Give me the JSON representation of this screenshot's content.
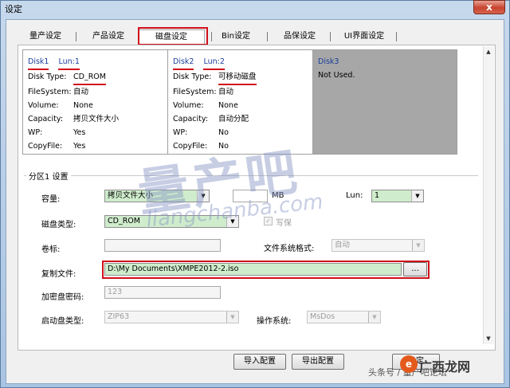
{
  "window": {
    "title": "设定",
    "close_glyph": "x"
  },
  "tabs": [
    {
      "label": "量产设定"
    },
    {
      "label": "产品设定"
    },
    {
      "label": "磁盘设定"
    },
    {
      "label": "Bin设定"
    },
    {
      "label": "品保设定"
    },
    {
      "label": "UI界面设定"
    }
  ],
  "disks": [
    {
      "name": "Disk1",
      "lun": "Lun:1",
      "rows": [
        [
          "Disk Type:",
          "CD_ROM"
        ],
        [
          "FileSystem:",
          "自动"
        ],
        [
          "Volume:",
          "None"
        ],
        [
          "Capacity:",
          "拷贝文件大小"
        ],
        [
          "WP:",
          "Yes"
        ],
        [
          "CopyFile:",
          "Yes"
        ]
      ]
    },
    {
      "name": "Disk2",
      "lun": "Lun:2",
      "rows": [
        [
          "Disk Type:",
          "可移动磁盘"
        ],
        [
          "FileSystem:",
          "自动"
        ],
        [
          "Volume:",
          "None"
        ],
        [
          "Capacity:",
          "自动分配"
        ],
        [
          "WP:",
          "No"
        ],
        [
          "CopyFile:",
          "No"
        ]
      ]
    },
    {
      "name": "Disk3",
      "status": "Not Used."
    }
  ],
  "partition": {
    "group_label": "分区1 设置",
    "capacity_label": "容量:",
    "capacity_value": "拷贝文件大小",
    "mb_unit": "MB",
    "lun_label": "Lun:",
    "lun_value": "1",
    "disk_type_label": "磁盘类型:",
    "disk_type_value": "CD_ROM",
    "wp_label": "写保",
    "volume_label": "卷标:",
    "fs_label": "文件系统格式:",
    "fs_value": "自动",
    "copy_label": "复制文件:",
    "copy_path": "D:\\My Documents\\XMPE2012-2.iso",
    "browse_label": "...",
    "password_label": "加密盘密码:",
    "password_value": "123",
    "boot_label": "启动盘类型:",
    "boot_value": "ZIP63",
    "os_label": "操作系统:",
    "os_value": "MsDos"
  },
  "buttons": {
    "import": "导入配置",
    "export": "导出配置",
    "ok": "确定"
  },
  "watermark": {
    "big": "量产吧",
    "url": "liangchanba.com",
    "credit": "头条号 / 量产吧论坛",
    "logo": "广西龙网"
  },
  "icons": {
    "scroll_up": "scroll-up-arrow",
    "scroll_down": "scroll-down-arrow",
    "dropdown": "chevron-down"
  }
}
